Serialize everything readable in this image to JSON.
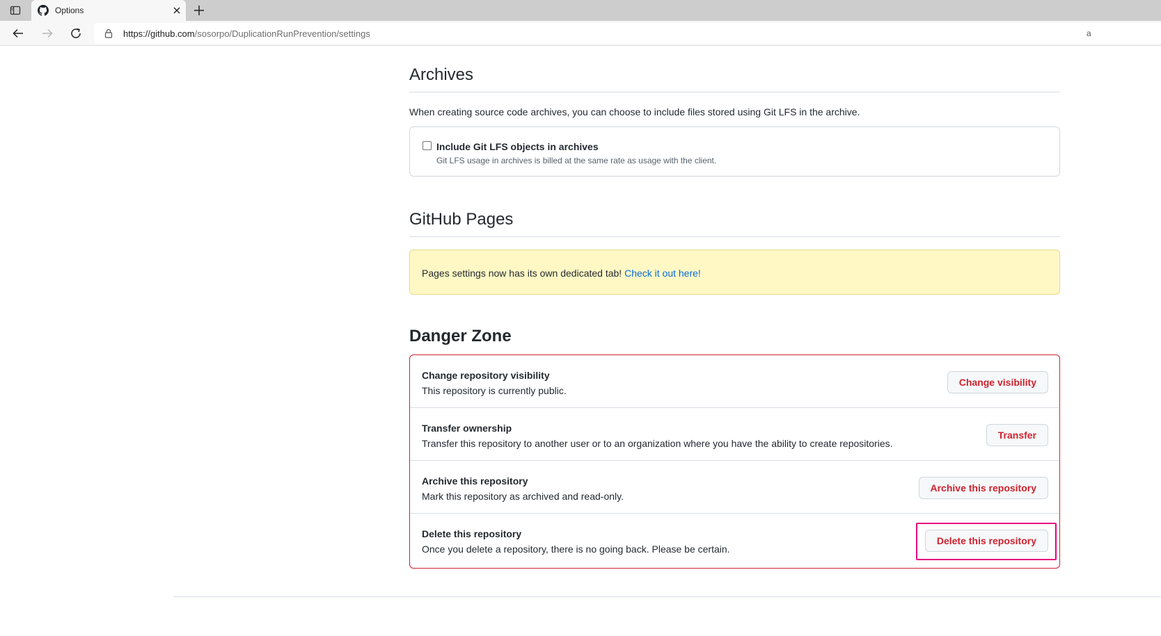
{
  "browser": {
    "tab_title": "Options",
    "url_host": "https://github.com",
    "url_path": "/sosorpo/DuplicationRunPrevention/settings",
    "url_extra": "a"
  },
  "archives": {
    "title": "Archives",
    "description": "When creating source code archives, you can choose to include files stored using Git LFS in the archive.",
    "checkbox_label": "Include Git LFS objects in archives",
    "checkbox_note": "Git LFS usage in archives is billed at the same rate as usage with the client.",
    "checkbox_checked": false
  },
  "pages": {
    "title": "GitHub Pages",
    "flash_text": "Pages settings now has its own dedicated tab! ",
    "flash_link": "Check it out here!"
  },
  "danger_zone": {
    "title": "Danger Zone",
    "rows": [
      {
        "title": "Change repository visibility",
        "description": "This repository is currently public.",
        "button": "Change visibility"
      },
      {
        "title": "Transfer ownership",
        "description": "Transfer this repository to another user or to an organization where you have the ability to create repositories.",
        "button": "Transfer"
      },
      {
        "title": "Archive this repository",
        "description": "Mark this repository as archived and read-only.",
        "button": "Archive this repository"
      },
      {
        "title": "Delete this repository",
        "description": "Once you delete a repository, there is no going back. Please be certain.",
        "button": "Delete this repository"
      }
    ]
  },
  "colors": {
    "danger": "#cf222e",
    "link": "#0969da",
    "flash_bg": "#fff8c5",
    "highlight": "#e6007e"
  }
}
